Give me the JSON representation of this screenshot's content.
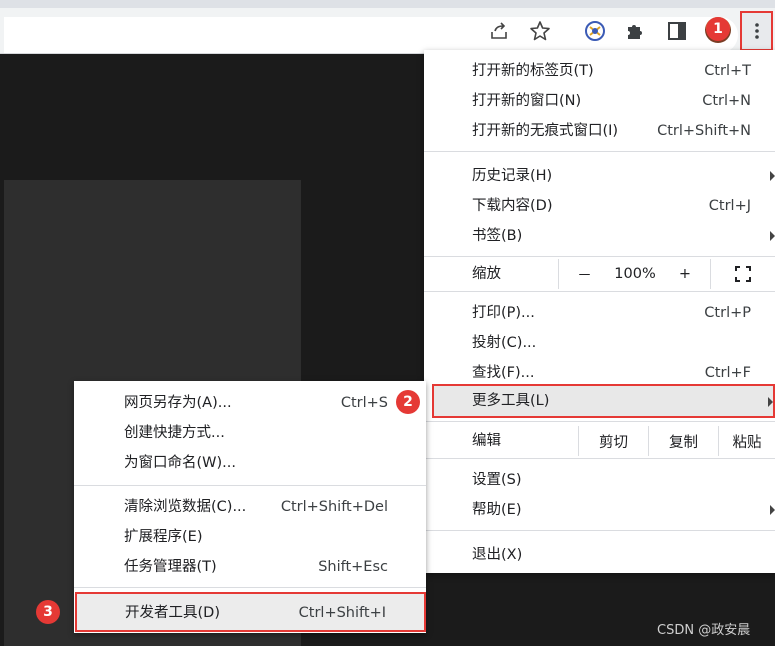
{
  "toolbar": {
    "icons": [
      "share-icon",
      "bookmark-star-icon",
      "extension-app-icon",
      "puzzle-extensions-icon",
      "side-panel-icon",
      "profile-avatar",
      "kebab-menu-icon"
    ]
  },
  "main_menu": {
    "items": [
      {
        "label": "打开新的标签页(T)",
        "shortcut": "Ctrl+T"
      },
      {
        "label": "打开新的窗口(N)",
        "shortcut": "Ctrl+N"
      },
      {
        "label": "打开新的无痕式窗口(I)",
        "shortcut": "Ctrl+Shift+N"
      },
      {
        "label": "历史记录(H)",
        "shortcut": ""
      },
      {
        "label": "下载内容(D)",
        "shortcut": "Ctrl+J"
      },
      {
        "label": "书签(B)",
        "shortcut": ""
      },
      {
        "label": "打印(P)...",
        "shortcut": "Ctrl+P"
      },
      {
        "label": "投射(C)...",
        "shortcut": ""
      },
      {
        "label": "查找(F)...",
        "shortcut": "Ctrl+F"
      },
      {
        "label": "更多工具(L)",
        "shortcut": ""
      },
      {
        "label": "设置(S)",
        "shortcut": ""
      },
      {
        "label": "帮助(E)",
        "shortcut": ""
      },
      {
        "label": "退出(X)",
        "shortcut": ""
      }
    ],
    "zoom": {
      "label": "缩放",
      "minus": "－",
      "value": "100%",
      "plus": "+"
    },
    "edit": {
      "label": "编辑",
      "cut": "剪切",
      "copy": "复制",
      "paste": "粘贴"
    }
  },
  "sub_menu": {
    "items": [
      {
        "label": "网页另存为(A)...",
        "shortcut": "Ctrl+S"
      },
      {
        "label": "创建快捷方式...",
        "shortcut": ""
      },
      {
        "label": "为窗口命名(W)...",
        "shortcut": ""
      },
      {
        "label": "清除浏览数据(C)...",
        "shortcut": "Ctrl+Shift+Del"
      },
      {
        "label": "扩展程序(E)",
        "shortcut": ""
      },
      {
        "label": "任务管理器(T)",
        "shortcut": "Shift+Esc"
      },
      {
        "label": "开发者工具(D)",
        "shortcut": "Ctrl+Shift+I"
      }
    ]
  },
  "steps": [
    "1",
    "2",
    "3"
  ],
  "watermark": "CSDN @政安晨",
  "colors": {
    "highlight": "#e53935",
    "menu_bg": "#ffffff",
    "page_bg": "#1b1b1b"
  }
}
